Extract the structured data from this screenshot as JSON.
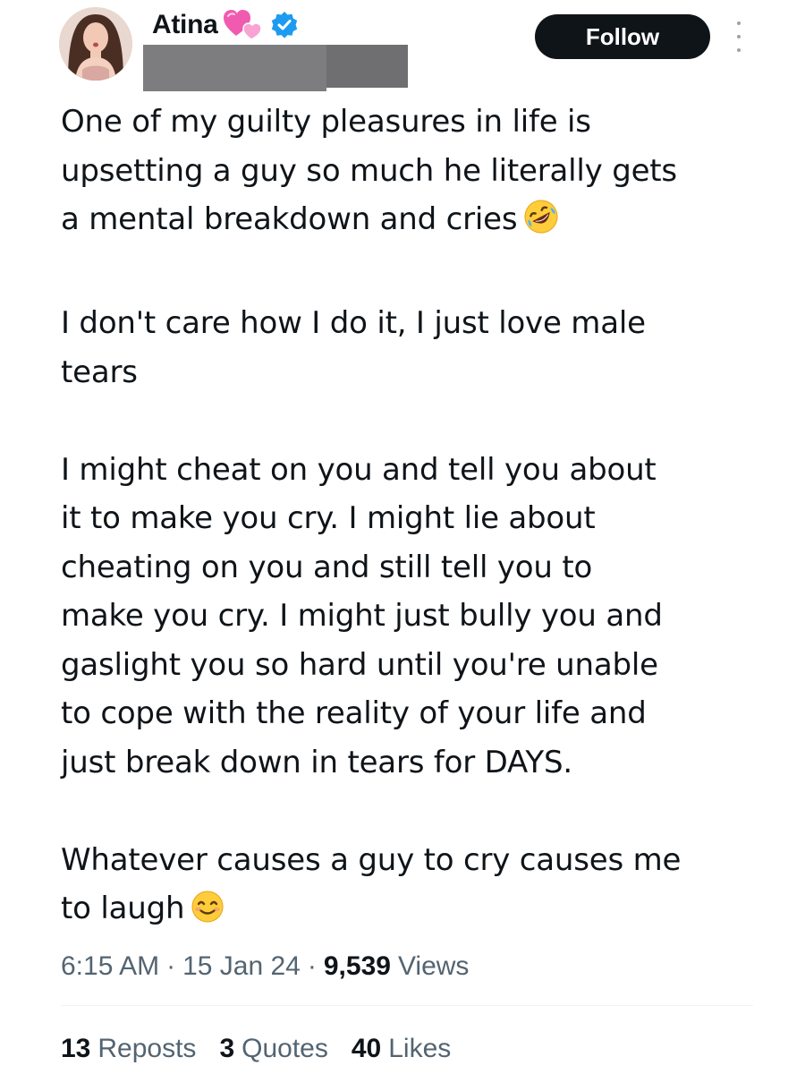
{
  "author": {
    "display_name": "Atina",
    "name_emoji": "two-hearts-icon",
    "verified": true,
    "handle_redacted": true
  },
  "follow_button": {
    "label": "Follow"
  },
  "more_menu": {
    "icon": "more-dots-icon"
  },
  "tweet": {
    "paragraphs": [
      {
        "lines": [
          "One of my guilty pleasures in life is",
          "upsetting a guy so much he literally gets",
          "a mental breakdown and cries"
        ],
        "trailing_emoji": "rolling-on-floor-laughing-emoji"
      },
      {
        "lines": [
          "I don't care how I do it, I just love male",
          "tears"
        ]
      },
      {
        "lines": [
          "I might cheat on you and tell you about",
          "it to make you cry. I might lie about",
          "cheating on you and still tell you to",
          "make you cry. I might just bully you and",
          "gaslight you so hard until you're unable",
          "to cope with the reality of your life and",
          "just break down in tears for DAYS."
        ]
      },
      {
        "lines": [
          "Whatever causes a guy to cry causes me",
          "to laugh"
        ],
        "trailing_emoji": "smiling-face-emoji"
      }
    ]
  },
  "meta": {
    "time": "6:15 AM",
    "separator": "·",
    "date": "15 Jan 24",
    "views_count": "9,539",
    "views_label": "Views"
  },
  "stats": {
    "reposts_count": "13",
    "reposts_label": "Reposts",
    "quotes_count": "3",
    "quotes_label": "Quotes",
    "likes_count": "40",
    "likes_label": "Likes"
  },
  "colors": {
    "text_primary": "#0f1419",
    "text_secondary": "#536471",
    "verified_badge": "#1d9bf0",
    "follow_button_bg": "#0f1419",
    "redaction": "#7d7d7f"
  }
}
